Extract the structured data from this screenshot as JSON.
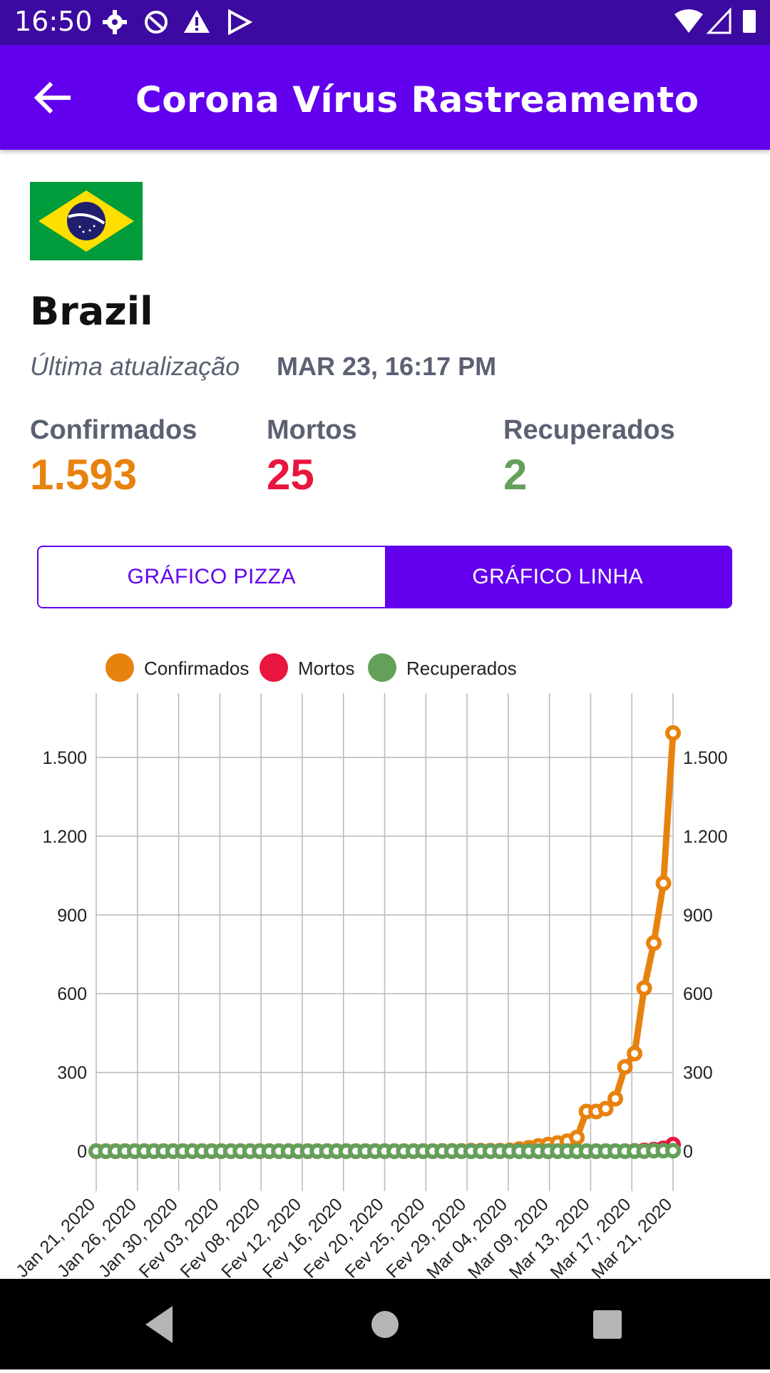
{
  "status": {
    "time": "16:50"
  },
  "header": {
    "title": "Corona Vírus Rastreamento"
  },
  "country": {
    "name": "Brazil"
  },
  "update": {
    "label": "Última atualização",
    "value": "MAR 23, 16:17 PM"
  },
  "stats": [
    {
      "label": "Confirmados",
      "value": "1.593",
      "color": "#e8820e"
    },
    {
      "label": "Mortos",
      "value": "25",
      "color": "#e8153f"
    },
    {
      "label": "Recuperados",
      "value": "2",
      "color": "#64a05a"
    }
  ],
  "tabs": [
    {
      "label": "GRÁFICO PIZZA",
      "active": false
    },
    {
      "label": "GRÁFICO LINHA",
      "active": true
    }
  ],
  "chart_data": {
    "type": "line",
    "legend": [
      "Confirmados",
      "Mortos",
      "Recuperados"
    ],
    "colors": [
      "#e8820e",
      "#e8153f",
      "#64a05a"
    ],
    "y_ticks": [
      "0",
      "300",
      "600",
      "900",
      "1.200",
      "1.500"
    ],
    "x_ticks": [
      "Jan 21, 2020",
      "Jan 26, 2020",
      "Jan 30, 2020",
      "Fev 03, 2020",
      "Fev 08, 2020",
      "Fev 12, 2020",
      "Fev 16, 2020",
      "Fev 20, 2020",
      "Fev 25, 2020",
      "Fev 29, 2020",
      "Mar 04, 2020",
      "Mar 09, 2020",
      "Mar 13, 2020",
      "Mar 17, 2020",
      "Mar 21, 2020"
    ],
    "ylim": [
      0,
      1500
    ],
    "series": [
      {
        "name": "Confirmados",
        "values": [
          0,
          0,
          0,
          0,
          0,
          0,
          0,
          0,
          0,
          0,
          0,
          0,
          0,
          0,
          0,
          0,
          0,
          0,
          0,
          0,
          0,
          0,
          0,
          0,
          0,
          0,
          0,
          0,
          0,
          0,
          0,
          0,
          0,
          0,
          0,
          0,
          1,
          1,
          1,
          2,
          2,
          2,
          2,
          3,
          8,
          13,
          20,
          25,
          31,
          38,
          52,
          151,
          151,
          162,
          200,
          321,
          372,
          621,
          793,
          1021,
          1593
        ]
      },
      {
        "name": "Mortos",
        "values": [
          0,
          0,
          0,
          0,
          0,
          0,
          0,
          0,
          0,
          0,
          0,
          0,
          0,
          0,
          0,
          0,
          0,
          0,
          0,
          0,
          0,
          0,
          0,
          0,
          0,
          0,
          0,
          0,
          0,
          0,
          0,
          0,
          0,
          0,
          0,
          0,
          0,
          0,
          0,
          0,
          0,
          0,
          0,
          0,
          0,
          0,
          0,
          0,
          0,
          0,
          0,
          0,
          0,
          0,
          0,
          0,
          1,
          3,
          6,
          11,
          25
        ]
      },
      {
        "name": "Recuperados",
        "values": [
          0,
          0,
          0,
          0,
          0,
          0,
          0,
          0,
          0,
          0,
          0,
          0,
          0,
          0,
          0,
          0,
          0,
          0,
          0,
          0,
          0,
          0,
          0,
          0,
          0,
          0,
          0,
          0,
          0,
          0,
          0,
          0,
          0,
          0,
          0,
          0,
          0,
          0,
          0,
          0,
          0,
          0,
          0,
          0,
          0,
          0,
          0,
          0,
          0,
          0,
          0,
          0,
          0,
          0,
          0,
          0,
          0,
          0,
          2,
          2,
          2
        ]
      }
    ]
  }
}
